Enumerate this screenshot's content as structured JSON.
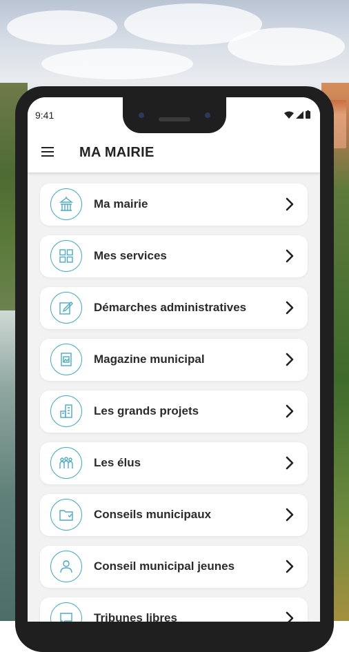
{
  "status_bar": {
    "time": "9:41"
  },
  "app_bar": {
    "title": "MA MAIRIE"
  },
  "menu_items": [
    {
      "label": "Ma mairie",
      "icon": "city-hall-icon"
    },
    {
      "label": "Mes services",
      "icon": "grid-icon"
    },
    {
      "label": "Démarches administratives",
      "icon": "edit-document-icon"
    },
    {
      "label": "Magazine municipal",
      "icon": "magazine-icon"
    },
    {
      "label": "Les grands projets",
      "icon": "buildings-icon"
    },
    {
      "label": "Les élus",
      "icon": "people-icon"
    },
    {
      "label": "Conseils municipaux",
      "icon": "folder-icon"
    },
    {
      "label": "Conseil municipal jeunes",
      "icon": "young-person-icon"
    },
    {
      "label": "Tribunes libres",
      "icon": "speech-bubble-icon"
    }
  ],
  "colors": {
    "accent": "#4aa8c8",
    "card": "#ffffff",
    "screen_bg": "#f2f2f2"
  }
}
